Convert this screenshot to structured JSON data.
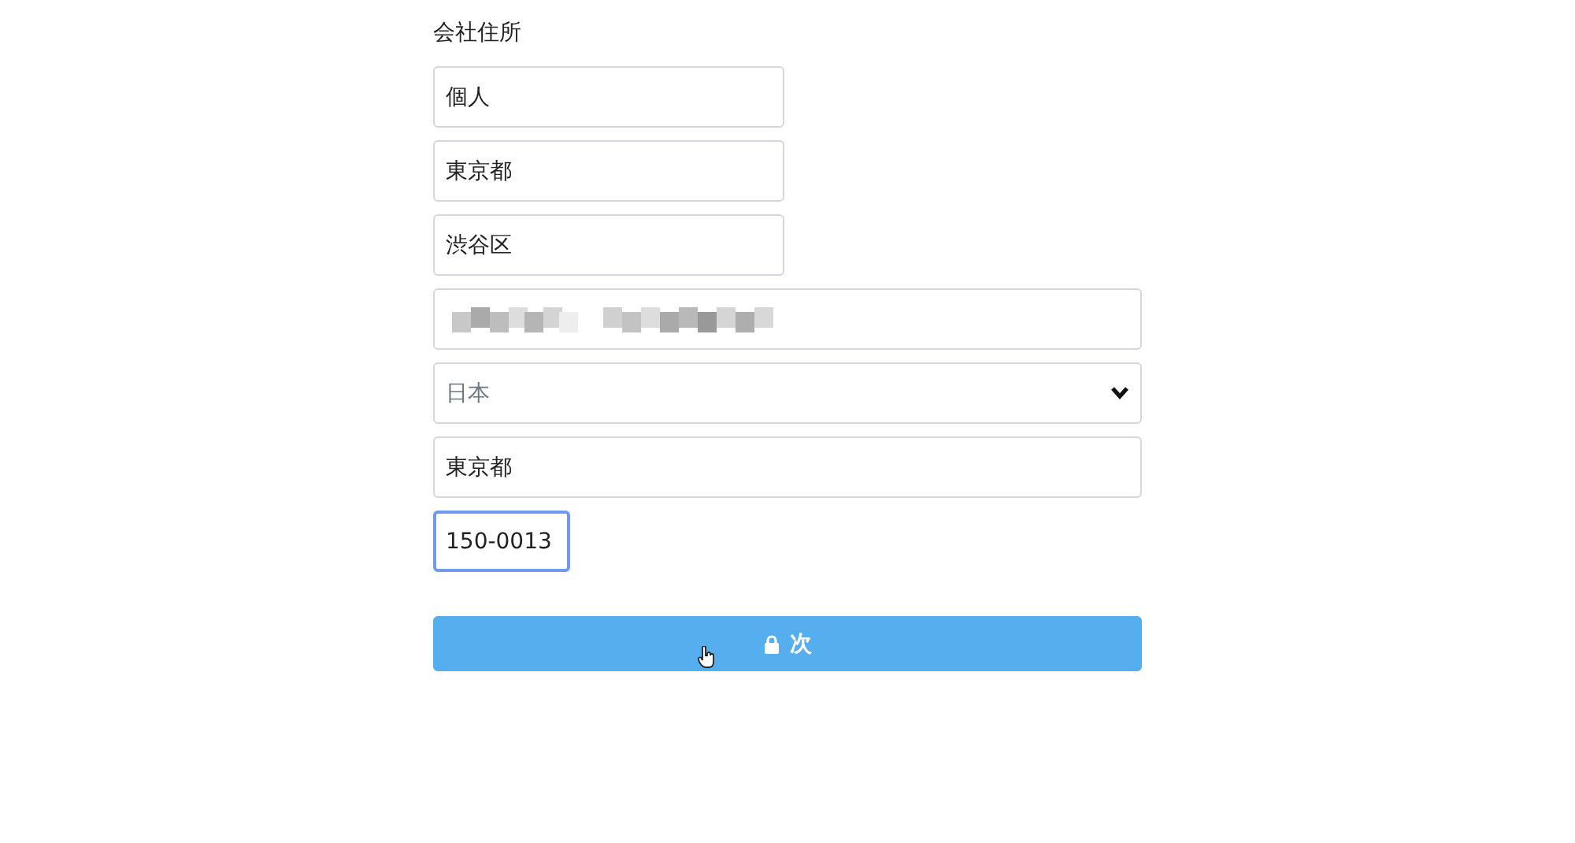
{
  "section_label": "会社住所",
  "fields": [
    {
      "kind": "short",
      "value": "個人",
      "focused": false
    },
    {
      "kind": "short",
      "value": "東京都",
      "focused": false
    },
    {
      "kind": "short",
      "value": "渋谷区",
      "focused": false
    },
    {
      "kind": "redacted",
      "focused": false
    },
    {
      "kind": "select",
      "value": "日本",
      "focused": false
    },
    {
      "kind": "wide",
      "value": "東京都",
      "focused": false
    },
    {
      "kind": "postal",
      "value": "150-0013",
      "focused": true
    }
  ],
  "submit_button": {
    "label": "次"
  }
}
